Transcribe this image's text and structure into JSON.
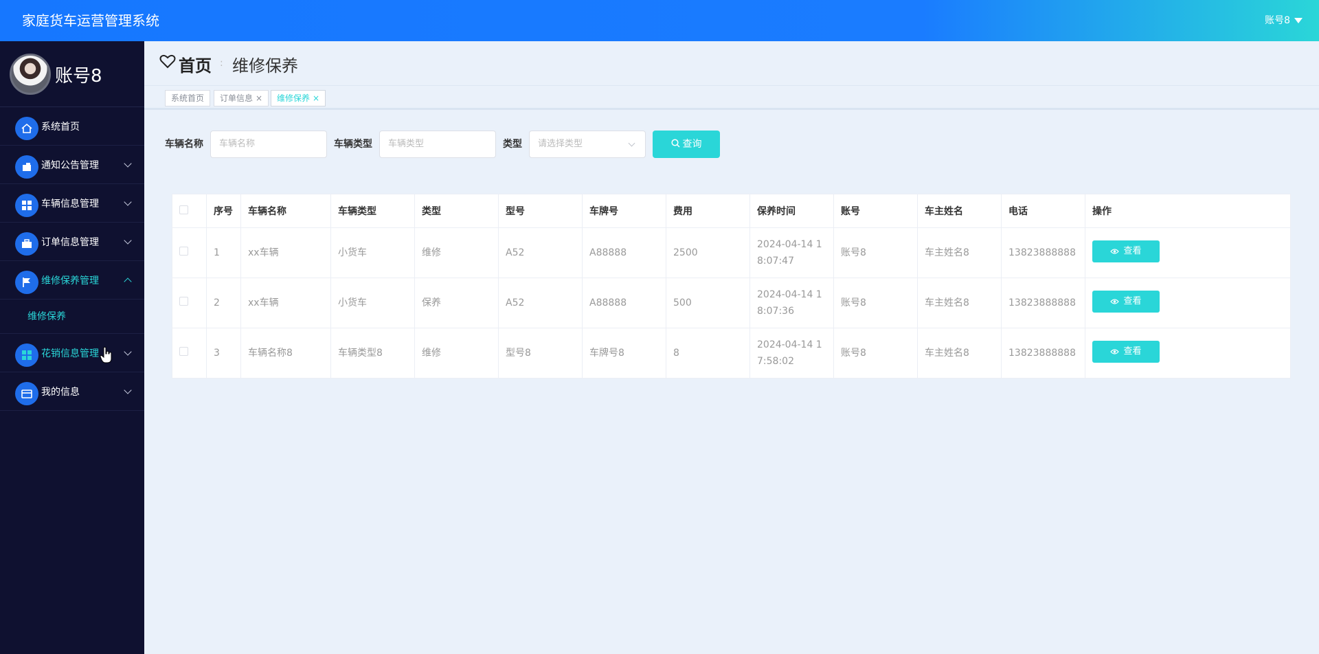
{
  "app": {
    "title": "家庭货车运营管理系统",
    "user": "账号8"
  },
  "profile": {
    "name": "账号8"
  },
  "sidebar": {
    "items": [
      {
        "label": "系统首页",
        "icon": "home-icon"
      },
      {
        "label": "通知公告管理",
        "icon": "cabinet-icon"
      },
      {
        "label": "车辆信息管理",
        "icon": "grid-icon"
      },
      {
        "label": "订单信息管理",
        "icon": "briefcase-icon"
      },
      {
        "label": "维修保养管理",
        "icon": "flag-icon"
      },
      {
        "label": "花销信息管理",
        "icon": "grid-icon"
      },
      {
        "label": "我的信息",
        "icon": "wallet-icon"
      }
    ],
    "submenu": {
      "label": "维修保养"
    }
  },
  "header": {
    "home": "首页",
    "separator": ":",
    "crumb": "维修保养"
  },
  "tabs": [
    {
      "label": "系统首页"
    },
    {
      "label": "订单信息",
      "close": "×"
    },
    {
      "label": "维修保养",
      "close": "×"
    }
  ],
  "search": {
    "name_label": "车辆名称",
    "name_placeholder": "车辆名称",
    "type_label": "车辆类型",
    "type_placeholder": "车辆类型",
    "kind_label": "类型",
    "kind_placeholder": "请选择类型",
    "button": "查询"
  },
  "table": {
    "headers": [
      "序号",
      "车辆名称",
      "车辆类型",
      "类型",
      "型号",
      "车牌号",
      "费用",
      "保养时间",
      "账号",
      "车主姓名",
      "电话",
      "操作"
    ],
    "rows": [
      {
        "no": "1",
        "name": "xx车辆",
        "vtype": "小货车",
        "kind": "维修",
        "model": "A52",
        "plate": "A88888",
        "cost": "2500",
        "time": "2024-04-14 18:07:47",
        "account": "账号8",
        "owner": "车主姓名8",
        "phone": "13823888888"
      },
      {
        "no": "2",
        "name": "xx车辆",
        "vtype": "小货车",
        "kind": "保养",
        "model": "A52",
        "plate": "A88888",
        "cost": "500",
        "time": "2024-04-14 18:07:36",
        "account": "账号8",
        "owner": "车主姓名8",
        "phone": "13823888888"
      },
      {
        "no": "3",
        "name": "车辆名称8",
        "vtype": "车辆类型8",
        "kind": "维修",
        "model": "型号8",
        "plate": "车牌号8",
        "cost": "8",
        "time": "2024-04-14 17:58:02",
        "account": "账号8",
        "owner": "车主姓名8",
        "phone": "13823888888"
      }
    ],
    "action_label": "查看"
  },
  "colors": {
    "accent": "#2ad6d8",
    "primary": "#1677ff",
    "sidebar": "#0f1130"
  }
}
